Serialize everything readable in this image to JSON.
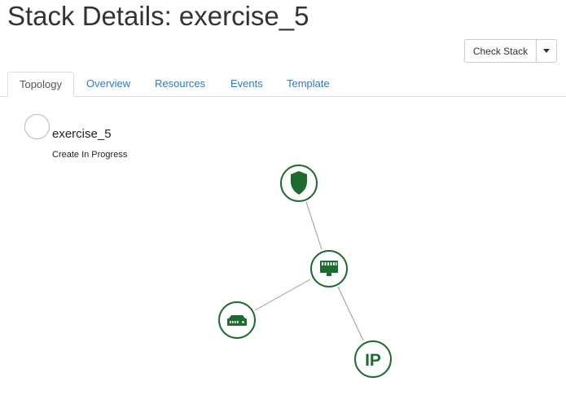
{
  "page": {
    "title": "Stack Details: exercise_5"
  },
  "actions": {
    "check_stack_label": "Check Stack"
  },
  "tabs": [
    {
      "label": "Topology",
      "active": true
    },
    {
      "label": "Overview",
      "active": false
    },
    {
      "label": "Resources",
      "active": false
    },
    {
      "label": "Events",
      "active": false
    },
    {
      "label": "Template",
      "active": false
    }
  ],
  "stack": {
    "name": "exercise_5",
    "status": "Create In Progress"
  },
  "topology": {
    "node_color": "#1e6b30",
    "link_color": "#999999",
    "nodes": [
      {
        "id": "security-group",
        "icon": "shield-icon"
      },
      {
        "id": "network",
        "icon": "ethernet-port-icon"
      },
      {
        "id": "router",
        "icon": "router-icon"
      },
      {
        "id": "floating-ip",
        "icon": "ip-icon",
        "label": "IP"
      }
    ],
    "links": [
      [
        "security-group",
        "network"
      ],
      [
        "network",
        "router"
      ],
      [
        "network",
        "floating-ip"
      ]
    ]
  }
}
